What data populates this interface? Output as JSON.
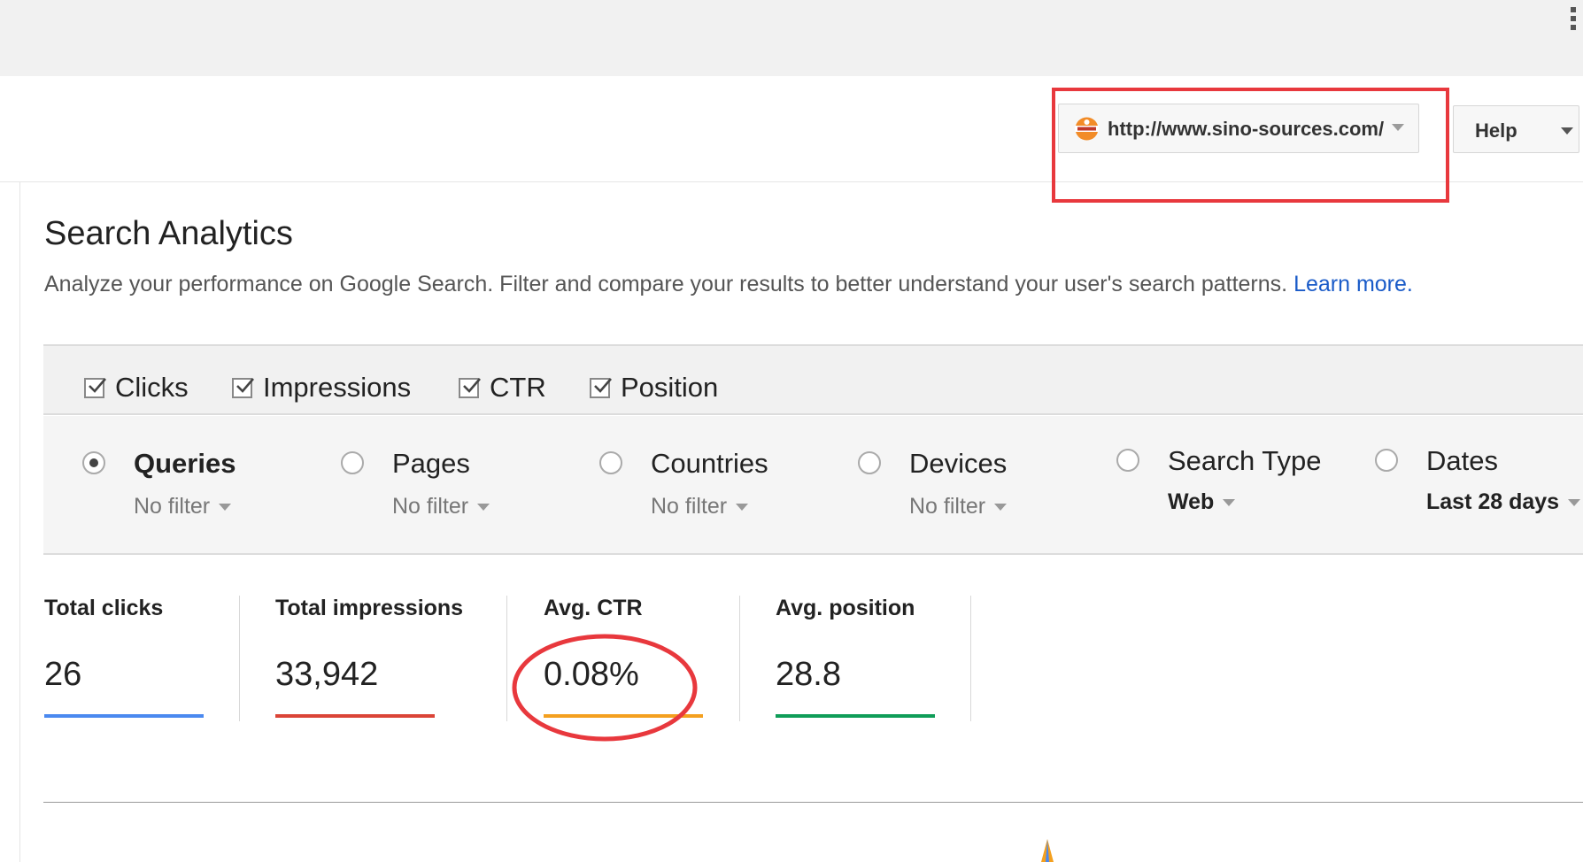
{
  "header": {
    "property_url": "http://www.sino-sources.com/",
    "help_label": "Help"
  },
  "page": {
    "title": "Search Analytics",
    "description": "Analyze your performance on Google Search. Filter and compare your results to better understand your user's search patterns.",
    "learn_more": "Learn more."
  },
  "metrics": [
    {
      "label": "Clicks",
      "checked": true
    },
    {
      "label": "Impressions",
      "checked": true
    },
    {
      "label": "CTR",
      "checked": true
    },
    {
      "label": "Position",
      "checked": true
    }
  ],
  "dimensions": [
    {
      "name": "Queries",
      "filter": "No filter",
      "selected": true
    },
    {
      "name": "Pages",
      "filter": "No filter",
      "selected": false
    },
    {
      "name": "Countries",
      "filter": "No filter",
      "selected": false
    },
    {
      "name": "Devices",
      "filter": "No filter",
      "selected": false
    },
    {
      "name": "Search Type",
      "filter": "Web",
      "selected": false
    },
    {
      "name": "Dates",
      "filter": "Last 28 days",
      "selected": false
    }
  ],
  "stats": [
    {
      "label": "Total clicks",
      "value": "26",
      "color": "#4a89f0"
    },
    {
      "label": "Total impressions",
      "value": "33,942",
      "color": "#db4437"
    },
    {
      "label": "Avg. CTR",
      "value": "0.08%",
      "color": "#f4a01f"
    },
    {
      "label": "Avg. position",
      "value": "28.8",
      "color": "#0f9d58"
    }
  ],
  "colors": {
    "annotation_red": "#e8383d",
    "link_blue": "#1a5bc8"
  }
}
